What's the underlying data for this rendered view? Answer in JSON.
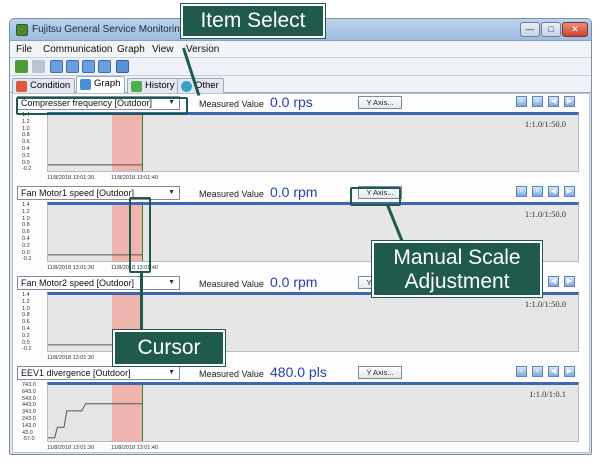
{
  "window": {
    "title": "Fujitsu General Service Monitoring",
    "controls": {
      "minimize": "—",
      "maximize": "□",
      "close": "✕"
    }
  },
  "menubar": {
    "items": [
      {
        "label": "File",
        "key": "F"
      },
      {
        "label": "Communication",
        "key": "C"
      },
      {
        "label": "Graph",
        "key": "G"
      },
      {
        "label": "View",
        "key": "V"
      },
      {
        "label": "Version",
        "key": "V"
      }
    ]
  },
  "toolbar": {
    "icons": [
      "leaf-icon",
      "disconnect-icon",
      "window-icon",
      "window-icon",
      "window-icon",
      "list-icon",
      "exit-icon"
    ]
  },
  "tabs": [
    {
      "label": "Condition",
      "active": false,
      "icon": "condition-icon",
      "color": "#e0583a"
    },
    {
      "label": "Graph",
      "active": true,
      "icon": "graph-icon",
      "color": "#4a8ed8"
    },
    {
      "label": "History",
      "active": false,
      "icon": "history-icon",
      "color": "#4cb050"
    },
    {
      "label": "Other",
      "active": false,
      "icon": "other-icon",
      "color": "#3aa0c8"
    }
  ],
  "graphs": [
    {
      "item": "Compresser frequency [Outdoor]",
      "measured_label": "Measured Value",
      "value": "0.0 rps",
      "yaxis_button": "Y Axis...",
      "scale": "1:1.0/1:50.0",
      "ticks": [
        "1.4",
        "1.2",
        "1.0",
        "0.8",
        "0.6",
        "0.4",
        "0.2",
        "0.0",
        "-0.2"
      ],
      "x_start": "11/8/2018 13:01:30",
      "x_end": "11/8/2018 13:01:40",
      "trace": [
        {
          "t": 0,
          "v": 0
        },
        {
          "t": 1,
          "v": 0
        }
      ]
    },
    {
      "item": "Fan Motor1 speed [Outdoor]",
      "measured_label": "Measured Value",
      "value": "0.0 rpm",
      "yaxis_button": "Y Axis...",
      "scale": "1:1.0/1:50.0",
      "ticks": [
        "1.4",
        "1.2",
        "1.0",
        "0.8",
        "0.6",
        "0.4",
        "0.2",
        "0.0",
        "-0.2"
      ],
      "x_start": "11/8/2018 13:01:30",
      "x_end": "11/8/2018 13:01:40",
      "trace": [
        {
          "t": 0,
          "v": 0
        },
        {
          "t": 1,
          "v": 0
        }
      ]
    },
    {
      "item": "Fan Motor2 speed [Outdoor]",
      "measured_label": "Measured Value",
      "value": "0.0 rpm",
      "yaxis_button": "Y Axis...",
      "scale": "1:1.0/1:50.0",
      "ticks": [
        "1.4",
        "1.2",
        "1.0",
        "0.8",
        "0.6",
        "0.4",
        "0.2",
        "0.0",
        "-0.2"
      ],
      "x_start": "11/8/2018 13:01:30",
      "x_end": "",
      "trace": [
        {
          "t": 0,
          "v": 0
        },
        {
          "t": 1,
          "v": 0
        }
      ]
    },
    {
      "item": "EEV1 divergence [Outdoor]",
      "measured_label": "Measured Value",
      "value": "480.0 pls",
      "yaxis_button": "Y Axis...",
      "scale": "1:1.0/1:0.1",
      "ticks": [
        "743.0",
        "643.0",
        "543.0",
        "443.0",
        "343.0",
        "243.0",
        "143.0",
        "43.0",
        "-57.0"
      ],
      "x_start": "11/8/2018 13:01:30",
      "x_end": "11/8/2018 13:01:40",
      "trace": [
        {
          "t": 0,
          "v": 0
        },
        {
          "t": 0.07,
          "v": 0
        },
        {
          "t": 0.1,
          "v": 150
        },
        {
          "t": 0.17,
          "v": 150
        },
        {
          "t": 0.2,
          "v": 380
        },
        {
          "t": 0.36,
          "v": 380
        },
        {
          "t": 0.4,
          "v": 480
        },
        {
          "t": 1,
          "v": 480
        }
      ]
    }
  ],
  "annotations": {
    "item_select": "Item Select",
    "manual_scale_line1": "Manual Scale",
    "manual_scale_line2": "Adjustment",
    "cursor": "Cursor"
  },
  "colors": {
    "value_text": "#2a3fb0",
    "plot_top_border": "#3e67b3",
    "cursor_band": "#f0b4ae",
    "cursor_line": "#3c7d28",
    "callout": "#1f5a4c"
  }
}
